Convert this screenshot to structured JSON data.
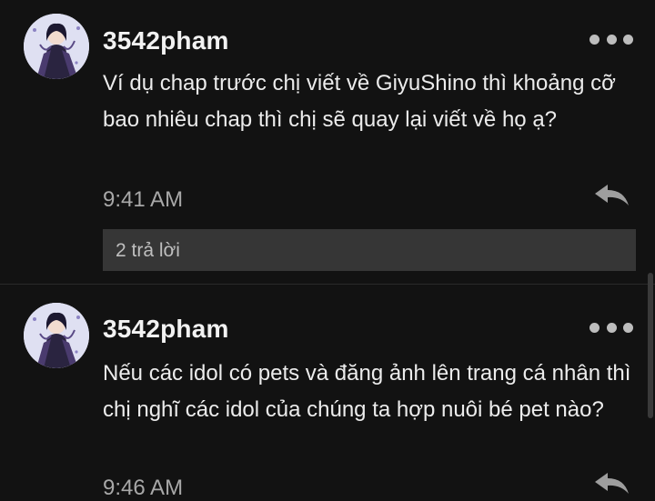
{
  "comments": [
    {
      "username": "3542pham",
      "text": "Ví dụ chap trước chị viết về GiyuShino thì khoảng cỡ bao nhiêu chap thì chị sẽ quay lại viết về họ ạ?",
      "time": "9:41 AM",
      "replies_label": "2 trả lời",
      "avatar_icon": "anime-avatar-icon",
      "more_icon": "more-options-icon",
      "reply_icon": "reply-arrow-icon"
    },
    {
      "username": "3542pham",
      "text": "Nếu các idol có pets và đăng ảnh lên trang cá nhân thì chị nghĩ các idol của chúng ta hợp nuôi bé pet nào?",
      "time": "9:46 AM",
      "avatar_icon": "anime-avatar-icon",
      "more_icon": "more-options-icon",
      "reply_icon": "reply-arrow-icon"
    }
  ],
  "colors": {
    "background": "#121212",
    "text": "#ececec",
    "muted": "#a8a8a8",
    "replies_bar": "#363636"
  }
}
